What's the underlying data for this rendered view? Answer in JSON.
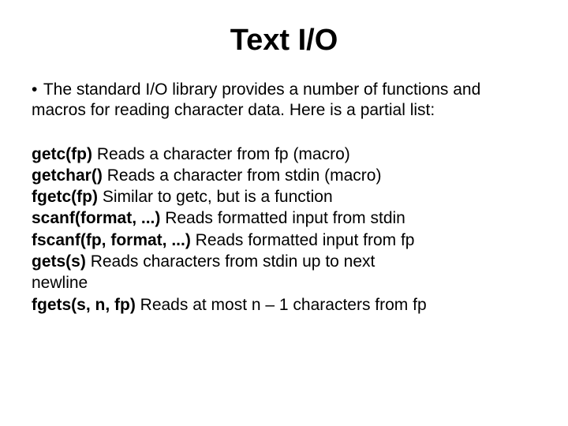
{
  "title": "Text I/O",
  "intro": {
    "bullet": "•",
    "text": "The standard I/O library provides a number of functions and macros for reading character data. Here is a partial list:"
  },
  "functions": [
    {
      "name": "getc(fp)",
      "desc": " Reads a character from fp (macro)"
    },
    {
      "name": "getchar()",
      "desc": " Reads a character from stdin (macro)"
    },
    {
      "name": "fgetc(fp)",
      "desc": " Similar to getc, but is a function"
    },
    {
      "name": "scanf(format, ...)",
      "desc": " Reads formatted input from stdin"
    },
    {
      "name": "fscanf(fp, format, ...)",
      "desc": " Reads formatted input from fp"
    },
    {
      "name": "gets(s)",
      "desc": " Reads characters from stdin up to next"
    },
    {
      "name": "",
      "desc": "newline"
    },
    {
      "name": "fgets(s, n, fp)",
      "desc": " Reads at most n – 1 characters from fp"
    }
  ]
}
